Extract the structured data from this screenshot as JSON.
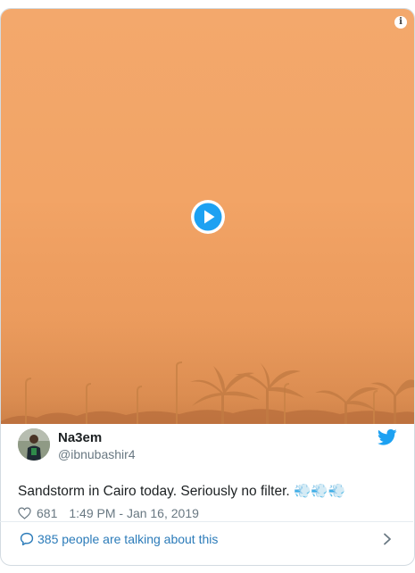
{
  "media": {
    "info_icon_glyph": "i",
    "play_icon": "play-circle",
    "accent": "#1da1f2"
  },
  "author": {
    "display_name": "Na3em",
    "handle": "@ibnubashir4"
  },
  "tweet": {
    "text": "Sandstorm in Cairo today. Seriously no filter. 💨💨💨",
    "like_count": "681",
    "timestamp": "1:49 PM - Jan 16, 2019"
  },
  "footer": {
    "talking_label": "385 people are talking about this"
  },
  "colors": {
    "sky_top": "#f3a86c",
    "sky_bottom": "#d98a4e",
    "text_primary": "#1c2022",
    "text_secondary": "#697882",
    "link": "#2b7bb9",
    "twitter_blue": "#1da1f2"
  }
}
